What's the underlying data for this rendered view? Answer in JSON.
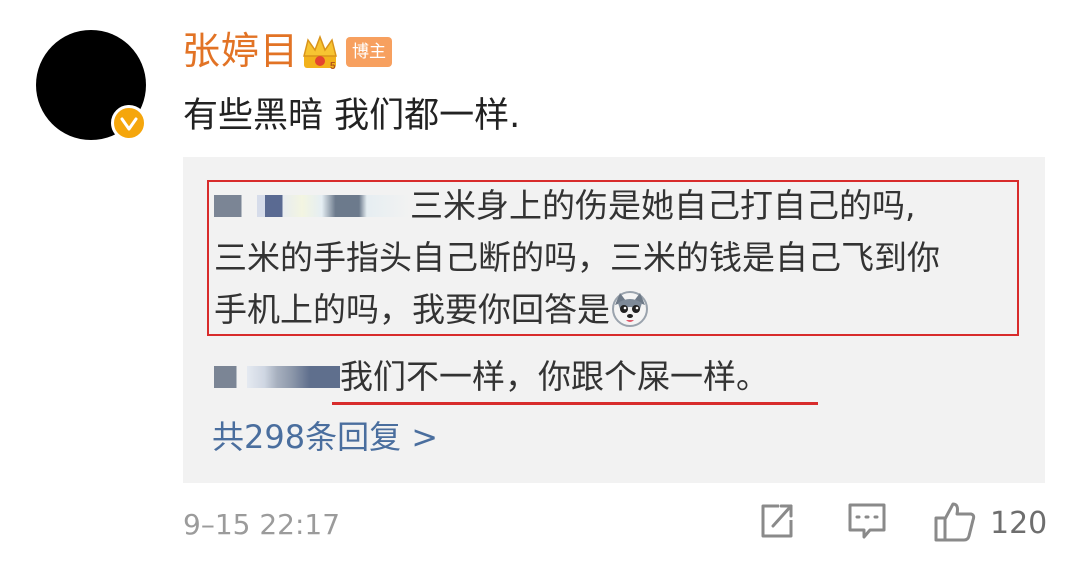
{
  "post": {
    "username": "张婷目",
    "badge": "博主",
    "text": "有些黑暗 我们都一样."
  },
  "reply": {
    "line1_text": "三米身上的伤是她自己打自己的吗,",
    "line2_text": "三米的手指头自己断的吗，三米的钱是自己飞到你",
    "line3_text": "手机上的吗，我要你回答是",
    "second_reply_text": "我们不一样，你跟个屎一样。",
    "more_replies": "共298条回复 >"
  },
  "footer": {
    "timestamp": "9–15 22:17",
    "like_count": "120"
  },
  "colors": {
    "username": "#e27325",
    "badge_bg": "#f7a05f",
    "verified": "#f5a60c",
    "highlight_red": "#d82c2c",
    "link_blue": "#4a6e9e"
  },
  "icons": [
    "verified-icon",
    "crown-icon",
    "husky-emoji-icon",
    "share-icon",
    "comment-icon",
    "like-icon"
  ]
}
